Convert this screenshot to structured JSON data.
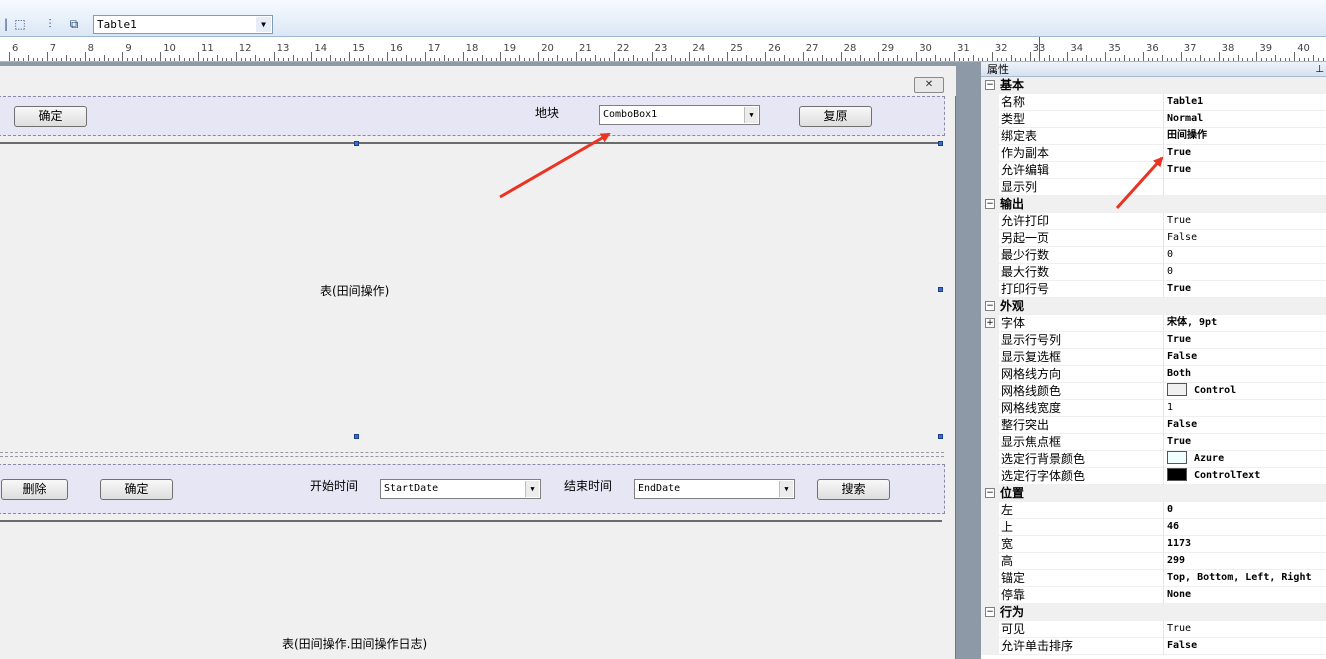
{
  "toolbar": {
    "object_select_value": "Table1"
  },
  "ruler": {
    "numbers": [
      "6",
      "7",
      "8",
      "9",
      "10",
      "11",
      "12",
      "13",
      "14",
      "15",
      "16",
      "17",
      "18",
      "19",
      "20",
      "21",
      "22",
      "23",
      "24",
      "25",
      "26",
      "27",
      "28",
      "29",
      "30",
      "31",
      "32",
      "33",
      "34",
      "35",
      "36",
      "37",
      "38",
      "39",
      "40"
    ]
  },
  "form": {
    "top_panel": {
      "confirm_label": "确定",
      "block_label": "地块",
      "combo_value": "ComboBox1",
      "reset_label": "复原"
    },
    "table1_caption": "表(田间操作)",
    "middle_panel": {
      "delete_label": "删除",
      "confirm_label": "确定",
      "start_label": "开始时间",
      "start_value": "StartDate",
      "end_label": "结束时间",
      "end_value": "EndDate",
      "search_label": "搜索"
    },
    "table2_caption": "表(田间操作.田间操作日志)"
  },
  "properties": {
    "title": "属性",
    "categories": [
      {
        "name": "基本",
        "rows": [
          {
            "name": "名称",
            "value": "Table1",
            "bold": true
          },
          {
            "name": "类型",
            "value": "Normal",
            "bold": true
          },
          {
            "name": "绑定表",
            "value": "田间操作",
            "bold": true
          },
          {
            "name": "作为副本",
            "value": "True",
            "bold": true
          },
          {
            "name": "允许编辑",
            "value": "True",
            "bold": true
          },
          {
            "name": "显示列",
            "value": "",
            "bold": false
          }
        ]
      },
      {
        "name": "输出",
        "rows": [
          {
            "name": "允许打印",
            "value": "True",
            "bold": false
          },
          {
            "name": "另起一页",
            "value": "False",
            "bold": false
          },
          {
            "name": "最少行数",
            "value": "0",
            "bold": false
          },
          {
            "name": "最大行数",
            "value": "0",
            "bold": false
          },
          {
            "name": "打印行号",
            "value": "True",
            "bold": true
          }
        ]
      },
      {
        "name": "外观",
        "rows": [
          {
            "name": "字体",
            "value": "宋体, 9pt",
            "bold": true,
            "expand": true
          },
          {
            "name": "显示行号列",
            "value": "True",
            "bold": true
          },
          {
            "name": "显示复选框",
            "value": "False",
            "bold": true
          },
          {
            "name": "网格线方向",
            "value": "Both",
            "bold": true
          },
          {
            "name": "网格线颜色",
            "value": "Control",
            "bold": true,
            "swatch": "#f0f0f0"
          },
          {
            "name": "网格线宽度",
            "value": "1",
            "bold": false
          },
          {
            "name": "整行突出",
            "value": "False",
            "bold": true
          },
          {
            "name": "显示焦点框",
            "value": "True",
            "bold": true
          },
          {
            "name": "选定行背景颜色",
            "value": "Azure",
            "bold": true,
            "swatch": "#f0ffff"
          },
          {
            "name": "选定行字体颜色",
            "value": "ControlText",
            "bold": true,
            "swatch": "#000000"
          }
        ]
      },
      {
        "name": "位置",
        "rows": [
          {
            "name": "左",
            "value": "0",
            "bold": true
          },
          {
            "name": "上",
            "value": "46",
            "bold": true
          },
          {
            "name": "宽",
            "value": "1173",
            "bold": true
          },
          {
            "name": "高",
            "value": "299",
            "bold": true
          },
          {
            "name": "锚定",
            "value": "Top, Bottom, Left, Right",
            "bold": true
          },
          {
            "name": "停靠",
            "value": "None",
            "bold": true
          }
        ]
      },
      {
        "name": "行为",
        "rows": [
          {
            "name": "可见",
            "value": "True",
            "bold": false
          },
          {
            "name": "允许单击排序",
            "value": "False",
            "bold": true
          }
        ]
      }
    ]
  },
  "colors": {
    "annotation_arrow": "#ea3323",
    "panel_bg": "#e6e6f5",
    "handle": "#3a6fd1"
  }
}
